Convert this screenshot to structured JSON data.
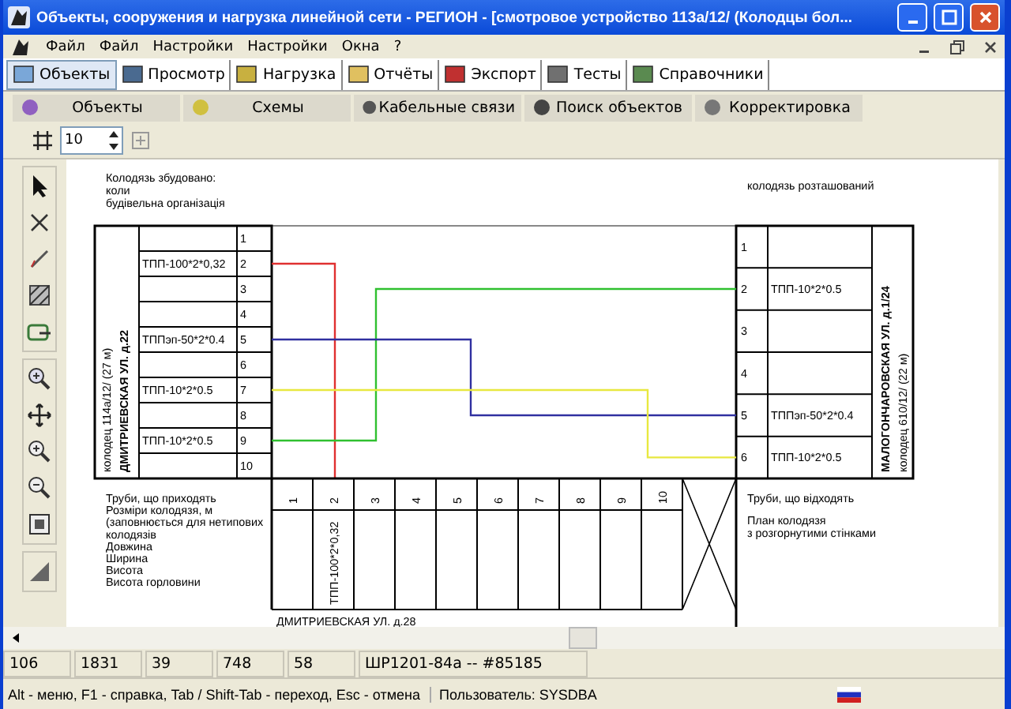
{
  "window": {
    "title": "Объекты, сооружения и нагрузка линейной сети - РЕГИОН - [смотровое устройство 113а/12/ (Колодцы бол..."
  },
  "menu": [
    "Файл",
    "Файл",
    "Настройки",
    "Настройки",
    "Окна",
    "?"
  ],
  "tabs": [
    {
      "label": "Объекты",
      "selected": true
    },
    {
      "label": "Просмотр",
      "selected": false
    },
    {
      "label": "Нагрузка",
      "selected": false
    },
    {
      "label": "Отчёты",
      "selected": false
    },
    {
      "label": "Экспорт",
      "selected": false
    },
    {
      "label": "Тесты",
      "selected": false
    },
    {
      "label": "Справочники",
      "selected": false
    }
  ],
  "sections": [
    "Объекты",
    "Схемы",
    "Кабельные связи",
    "Поиск объектов",
    "Корректировка"
  ],
  "scale": {
    "value": "10"
  },
  "drawing": {
    "top_left_notes": [
      "Колодязь збудовано:",
      "коли",
      "будівельна організація"
    ],
    "top_right_note": "колодязь розташований",
    "left_well": {
      "lines": [
        "колодец 114а/12/ (27 м)",
        "ДМИТРИЕВСКАЯ УЛ. д.22"
      ],
      "rows": [
        {
          "number": "1"
        },
        {
          "number": "2",
          "cable": "ТПП-100*2*0,32"
        },
        {
          "number": "3"
        },
        {
          "number": "4"
        },
        {
          "number": "5",
          "cable": "ТППэп-50*2*0.4"
        },
        {
          "number": "6"
        },
        {
          "number": "7",
          "cable": "ТПП-10*2*0.5"
        },
        {
          "number": "8"
        },
        {
          "number": "9",
          "cable": "ТПП-10*2*0.5"
        },
        {
          "number": "10"
        }
      ]
    },
    "right_well": {
      "lines": [
        "МАЛОГОНЧАРОВСКАЯ УЛ. д.1/24",
        "колодец 610/12/ (22 м)"
      ],
      "rows": [
        {
          "number": "1"
        },
        {
          "number": "2",
          "cable": "ТПП-10*2*0.5"
        },
        {
          "number": "3"
        },
        {
          "number": "4"
        },
        {
          "number": "5",
          "cable": "ТППэп-50*2*0.4"
        },
        {
          "number": "6",
          "cable": "ТПП-10*2*0.5"
        }
      ]
    },
    "connections": [
      {
        "color": "#e03030"
      },
      {
        "color": "#30c030"
      },
      {
        "color": "#3030a0"
      },
      {
        "color": "#e8e840"
      }
    ],
    "left_notes": [
      "Труби, що приходять",
      "Розміри колодязя, м",
      "(заповнюється для нетипових",
      "колодязів",
      "Довжина",
      "Ширина",
      "Висота",
      "Висота горловини"
    ],
    "right_notes": [
      "Труби, що відходять",
      "План колодязя",
      "з розгорнутими стінками"
    ],
    "ducts": [
      {
        "number": "1"
      },
      {
        "number": "2",
        "cable": "ТПП-100*2*0,32"
      },
      {
        "number": "3"
      },
      {
        "number": "4"
      },
      {
        "number": "5"
      },
      {
        "number": "6"
      },
      {
        "number": "7"
      },
      {
        "number": "8"
      },
      {
        "number": "9"
      },
      {
        "number": "10"
      }
    ],
    "bottom_address": "ДМИТРИЕВСКАЯ УЛ. д.28"
  },
  "status_cells": [
    "106",
    "1831",
    "39",
    "748",
    "58",
    "ШР1201-84а -- #85185"
  ],
  "status_bar": {
    "hint": "Alt - меню, F1 - справка, Tab / Shift-Tab - переход, Esc - отмена",
    "user": "Пользователь: SYSDBA"
  }
}
